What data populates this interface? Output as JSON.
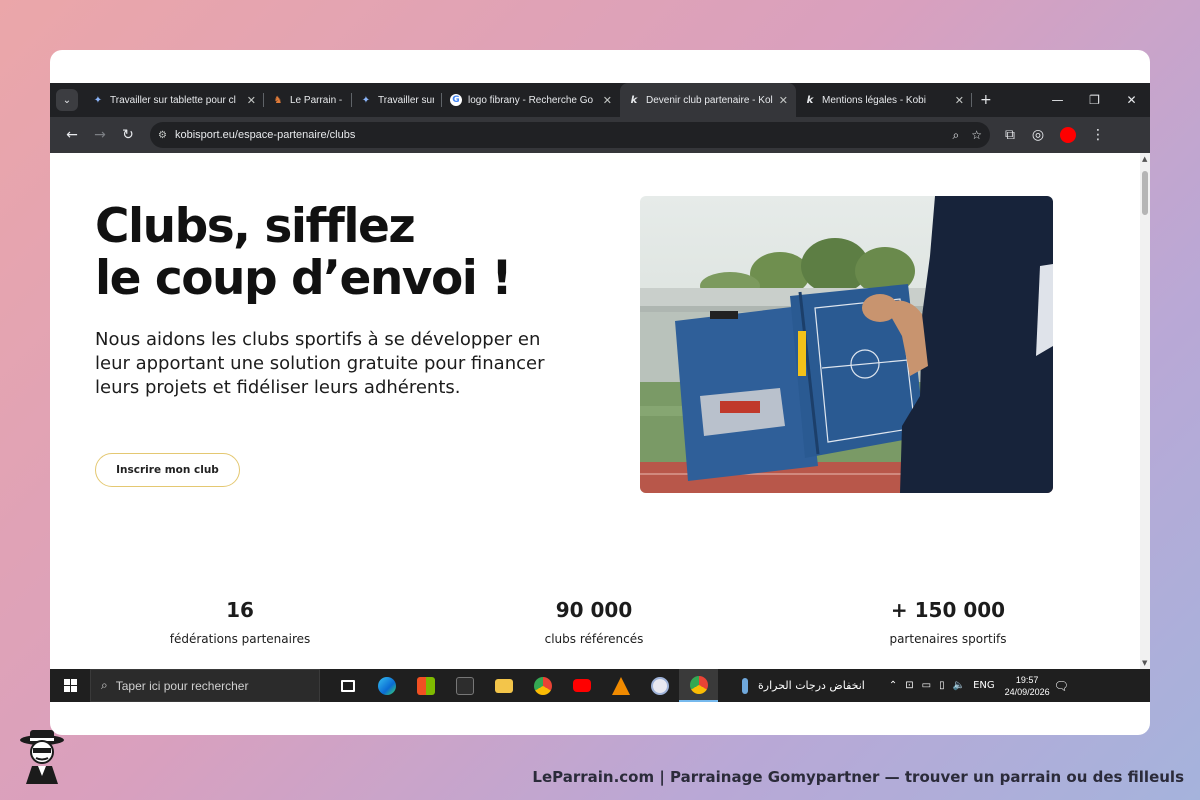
{
  "browser": {
    "tabs": [
      {
        "title": "Travailler sur tablette pour cl",
        "favicon": "gemini-sparkle-icon",
        "active": false
      },
      {
        "title": "Le Parrain - ",
        "favicon": "le-parrain-icon",
        "active": false
      },
      {
        "title": "Travailler sur",
        "favicon": "gemini-sparkle-icon",
        "active": false
      },
      {
        "title": "logo fibrany - Recherche Go",
        "favicon": "google-icon",
        "active": false
      },
      {
        "title": "Devenir club partenaire - Kol",
        "favicon": "kobi-icon",
        "active": true
      },
      {
        "title": "Mentions légales - Kobi",
        "favicon": "kobi-icon",
        "active": false
      }
    ],
    "close_glyph": "✕",
    "new_tab_glyph": "+",
    "url": "kobisport.eu/espace-partenaire/clubs",
    "profile_color": "#ff0000"
  },
  "page": {
    "title_line1": "Clubs, sifflez",
    "title_line2": "le coup d’envoi !",
    "intro": "Nous aidons les clubs sportifs à se développer en leur apportant une solution gratuite pour financer leurs projets et fidéliser leurs adhérents.",
    "cta_label": "Inscrire mon club",
    "cta_border_color": "#e4c872",
    "stats": [
      {
        "value": "16",
        "label": "fédérations partenaires"
      },
      {
        "value": "90 000",
        "label": "clubs référencés"
      },
      {
        "value": "+ 150 000",
        "label": "partenaires sportifs"
      }
    ]
  },
  "taskbar": {
    "search_placeholder": "Taper ici pour rechercher",
    "weather_text": "انخفاض درجات الحرارة",
    "language": "ENG",
    "time": "19:57",
    "date": "24/09/2026"
  },
  "footer": {
    "text": "LeParrain.com | Parrainage Gomypartner — trouver un parrain ou des filleuls"
  }
}
